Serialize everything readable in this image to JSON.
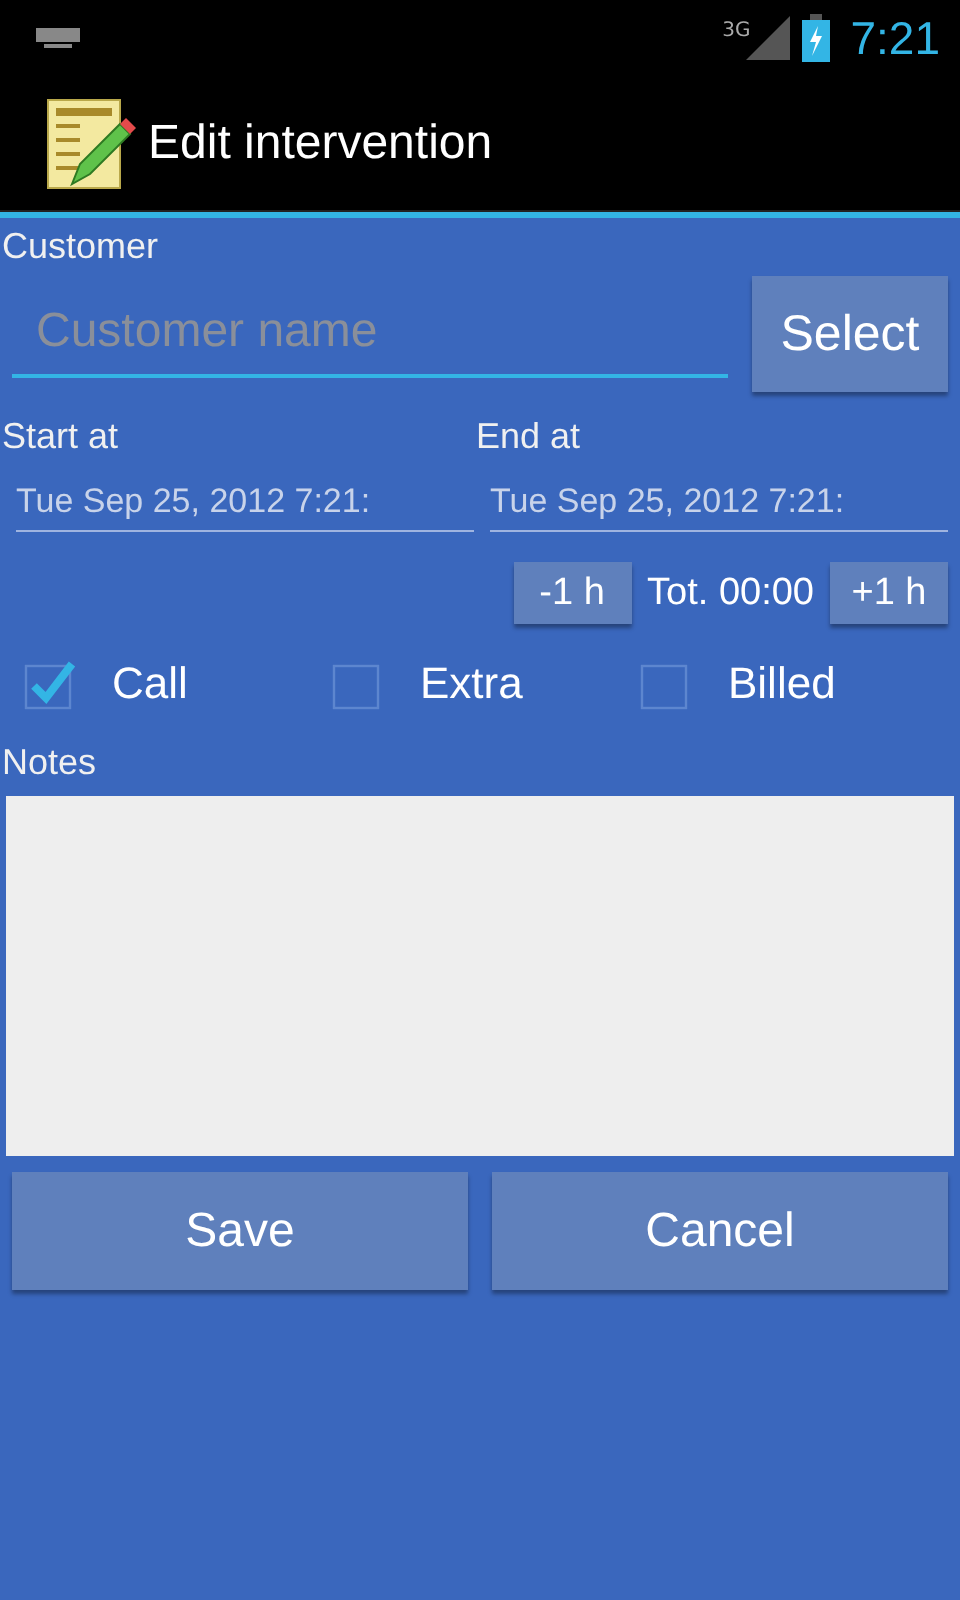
{
  "status_bar": {
    "network": "3G",
    "time": "7:21"
  },
  "action_bar": {
    "title": "Edit intervention"
  },
  "customer": {
    "label": "Customer",
    "placeholder": "Customer name",
    "button": "Select"
  },
  "start": {
    "label": "Start at",
    "value": "Tue Sep 25, 2012 7:21:"
  },
  "end": {
    "label": "End at",
    "value": "Tue Sep 25, 2012 7:21:"
  },
  "duration": {
    "minus": "-1 h",
    "total": "Tot. 00:00",
    "plus": "+1 h"
  },
  "checkboxes": [
    {
      "label": "Call",
      "checked": true
    },
    {
      "label": "Extra",
      "checked": false
    },
    {
      "label": "Billed",
      "checked": false
    }
  ],
  "notes": {
    "label": "Notes"
  },
  "buttons": [
    "Save",
    "Cancel"
  ]
}
